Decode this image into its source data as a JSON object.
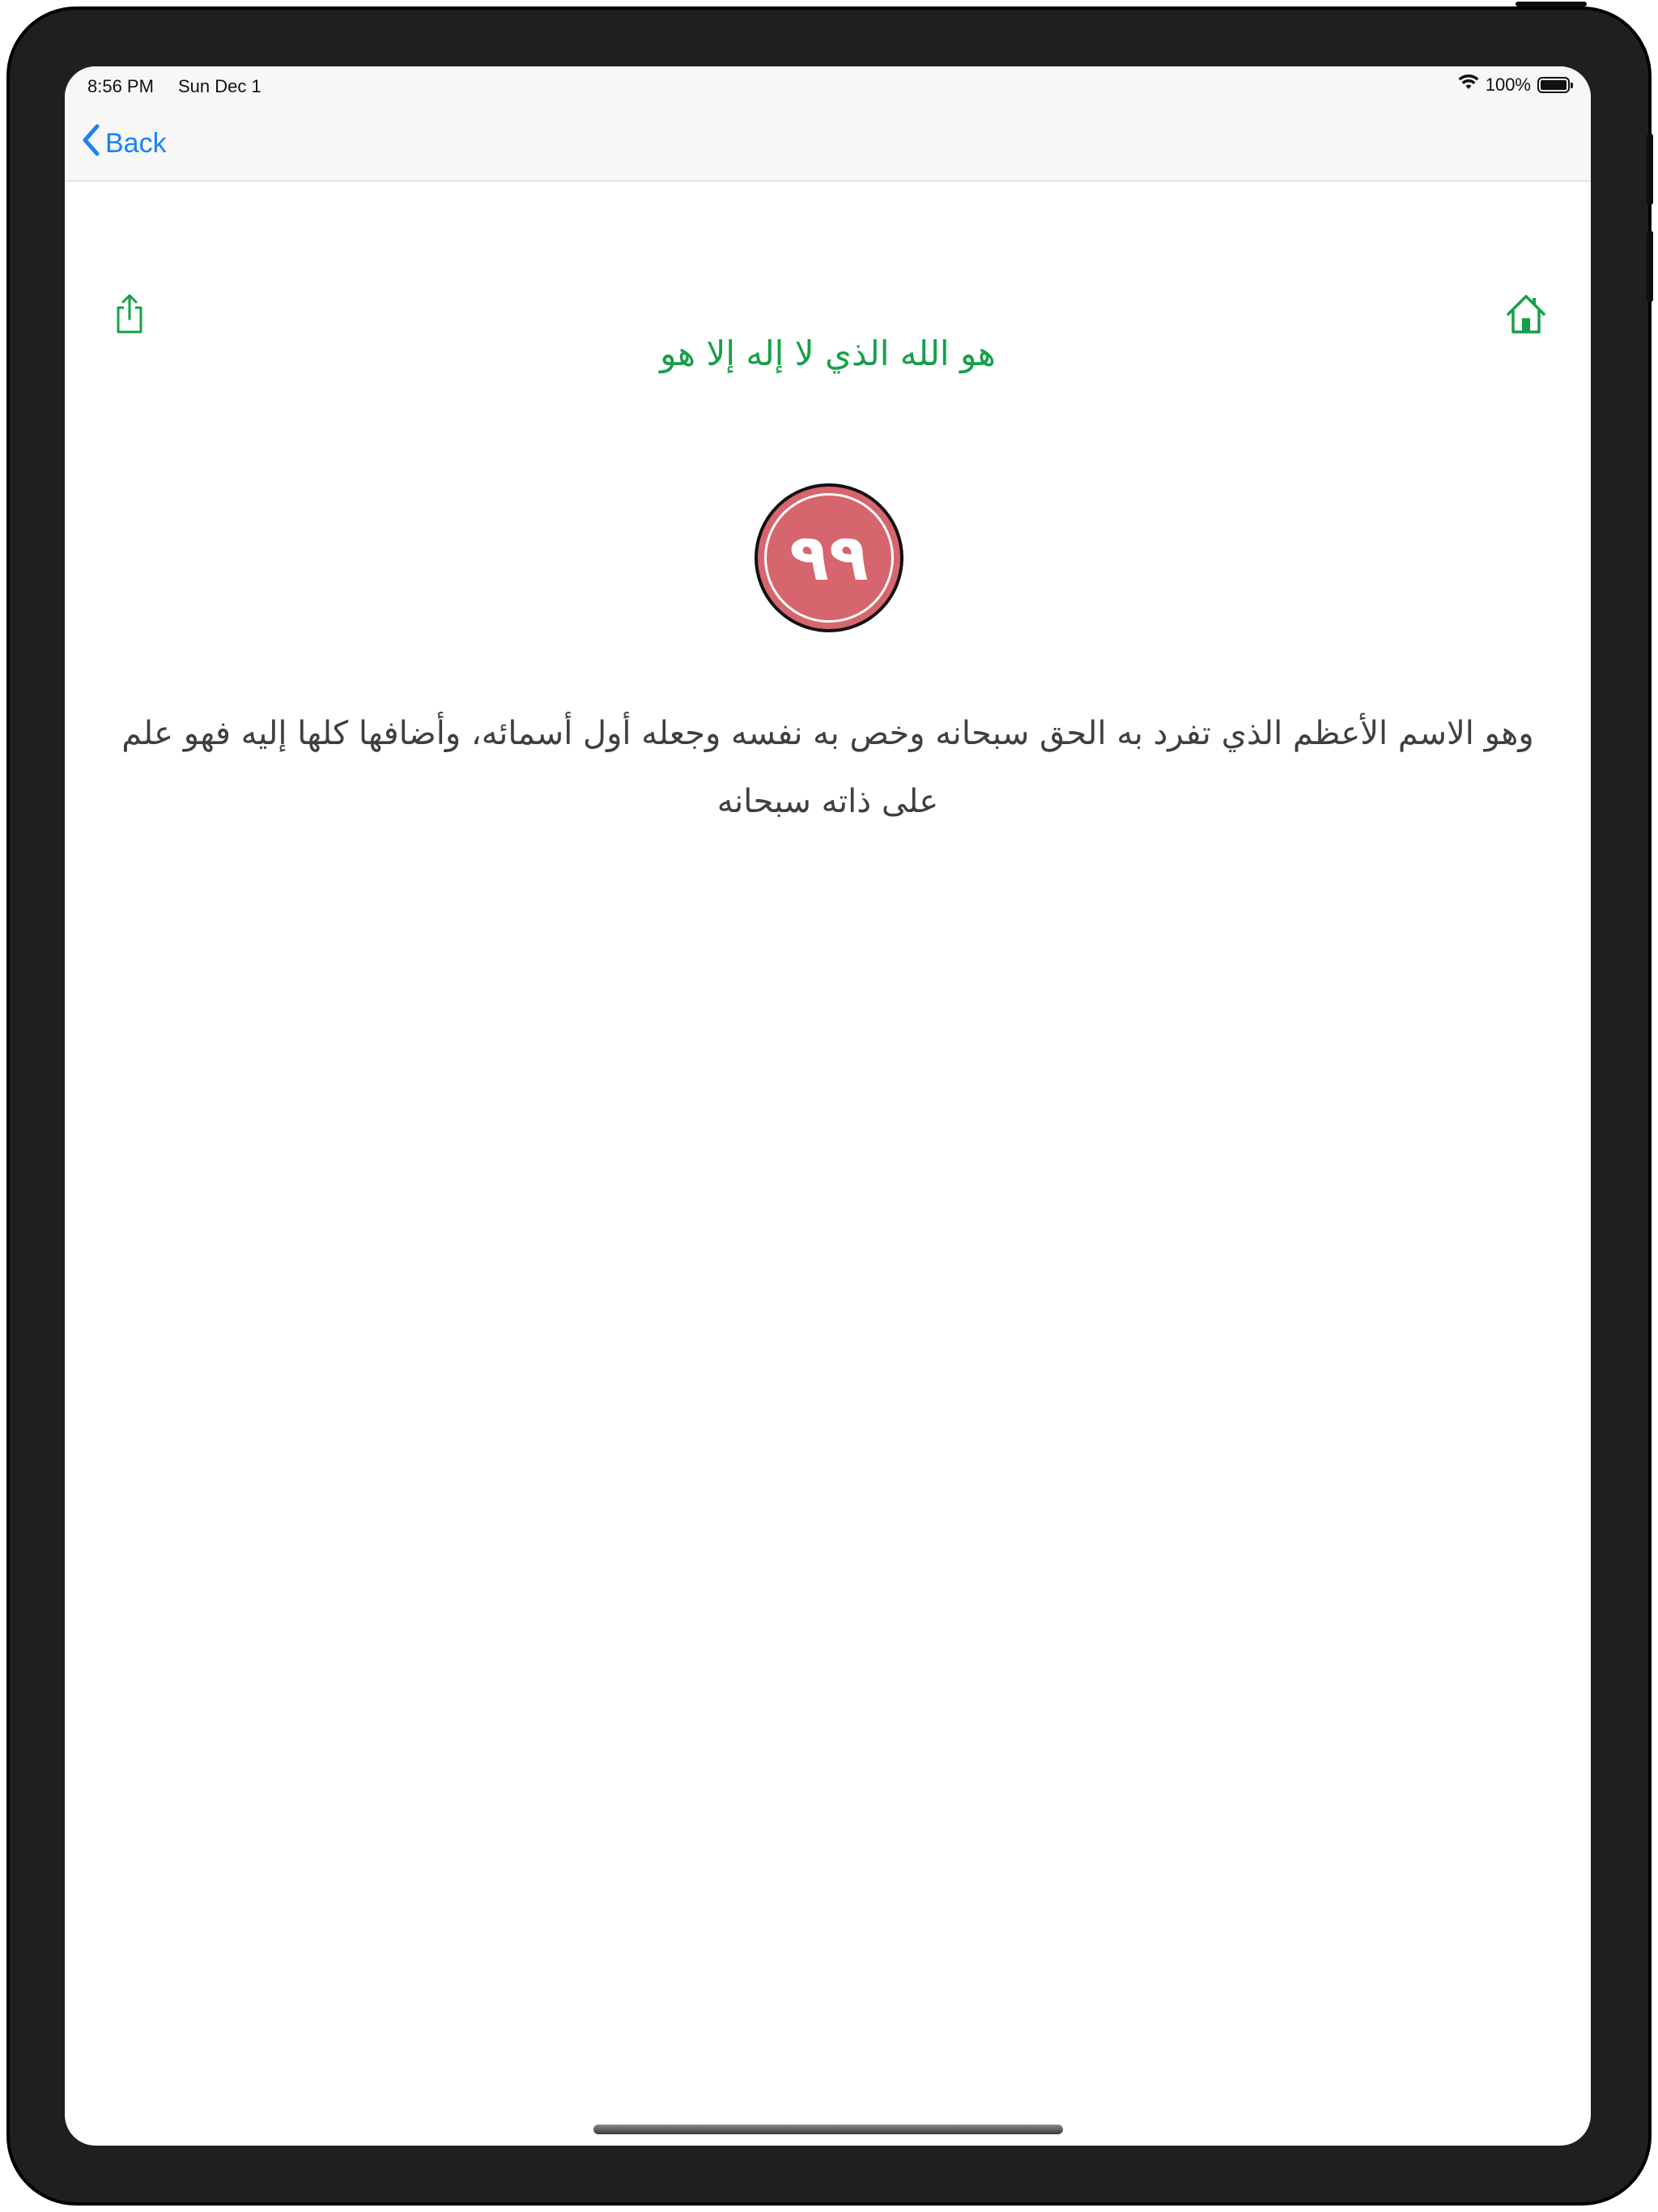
{
  "status_bar": {
    "time": "8:56 PM",
    "date": "Sun Dec 1",
    "battery_percent_text": "100%",
    "battery_level": 1.0,
    "wifi_icon": "wifi-icon",
    "battery_icon": "battery-icon"
  },
  "nav": {
    "back_label": "Back",
    "back_icon": "chevron-left-icon"
  },
  "toolbar": {
    "share_icon": "share-icon",
    "home_icon": "home-icon"
  },
  "content": {
    "heading": "هو الله الذي لا إله إلا هو",
    "badge_number": "٩٩",
    "description": "وهو الاسم الأعظم الذي تفرد به الحق سبحانه وخص به نفسه وجعله أول أسمائه، وأضافها كلها إليه فهو علم على ذاته سبحانه"
  },
  "colors": {
    "accent_green": "#16a048",
    "ios_blue": "#1a82f7",
    "badge_red": "#d6656d",
    "text_gray": "#3f3f3f"
  }
}
